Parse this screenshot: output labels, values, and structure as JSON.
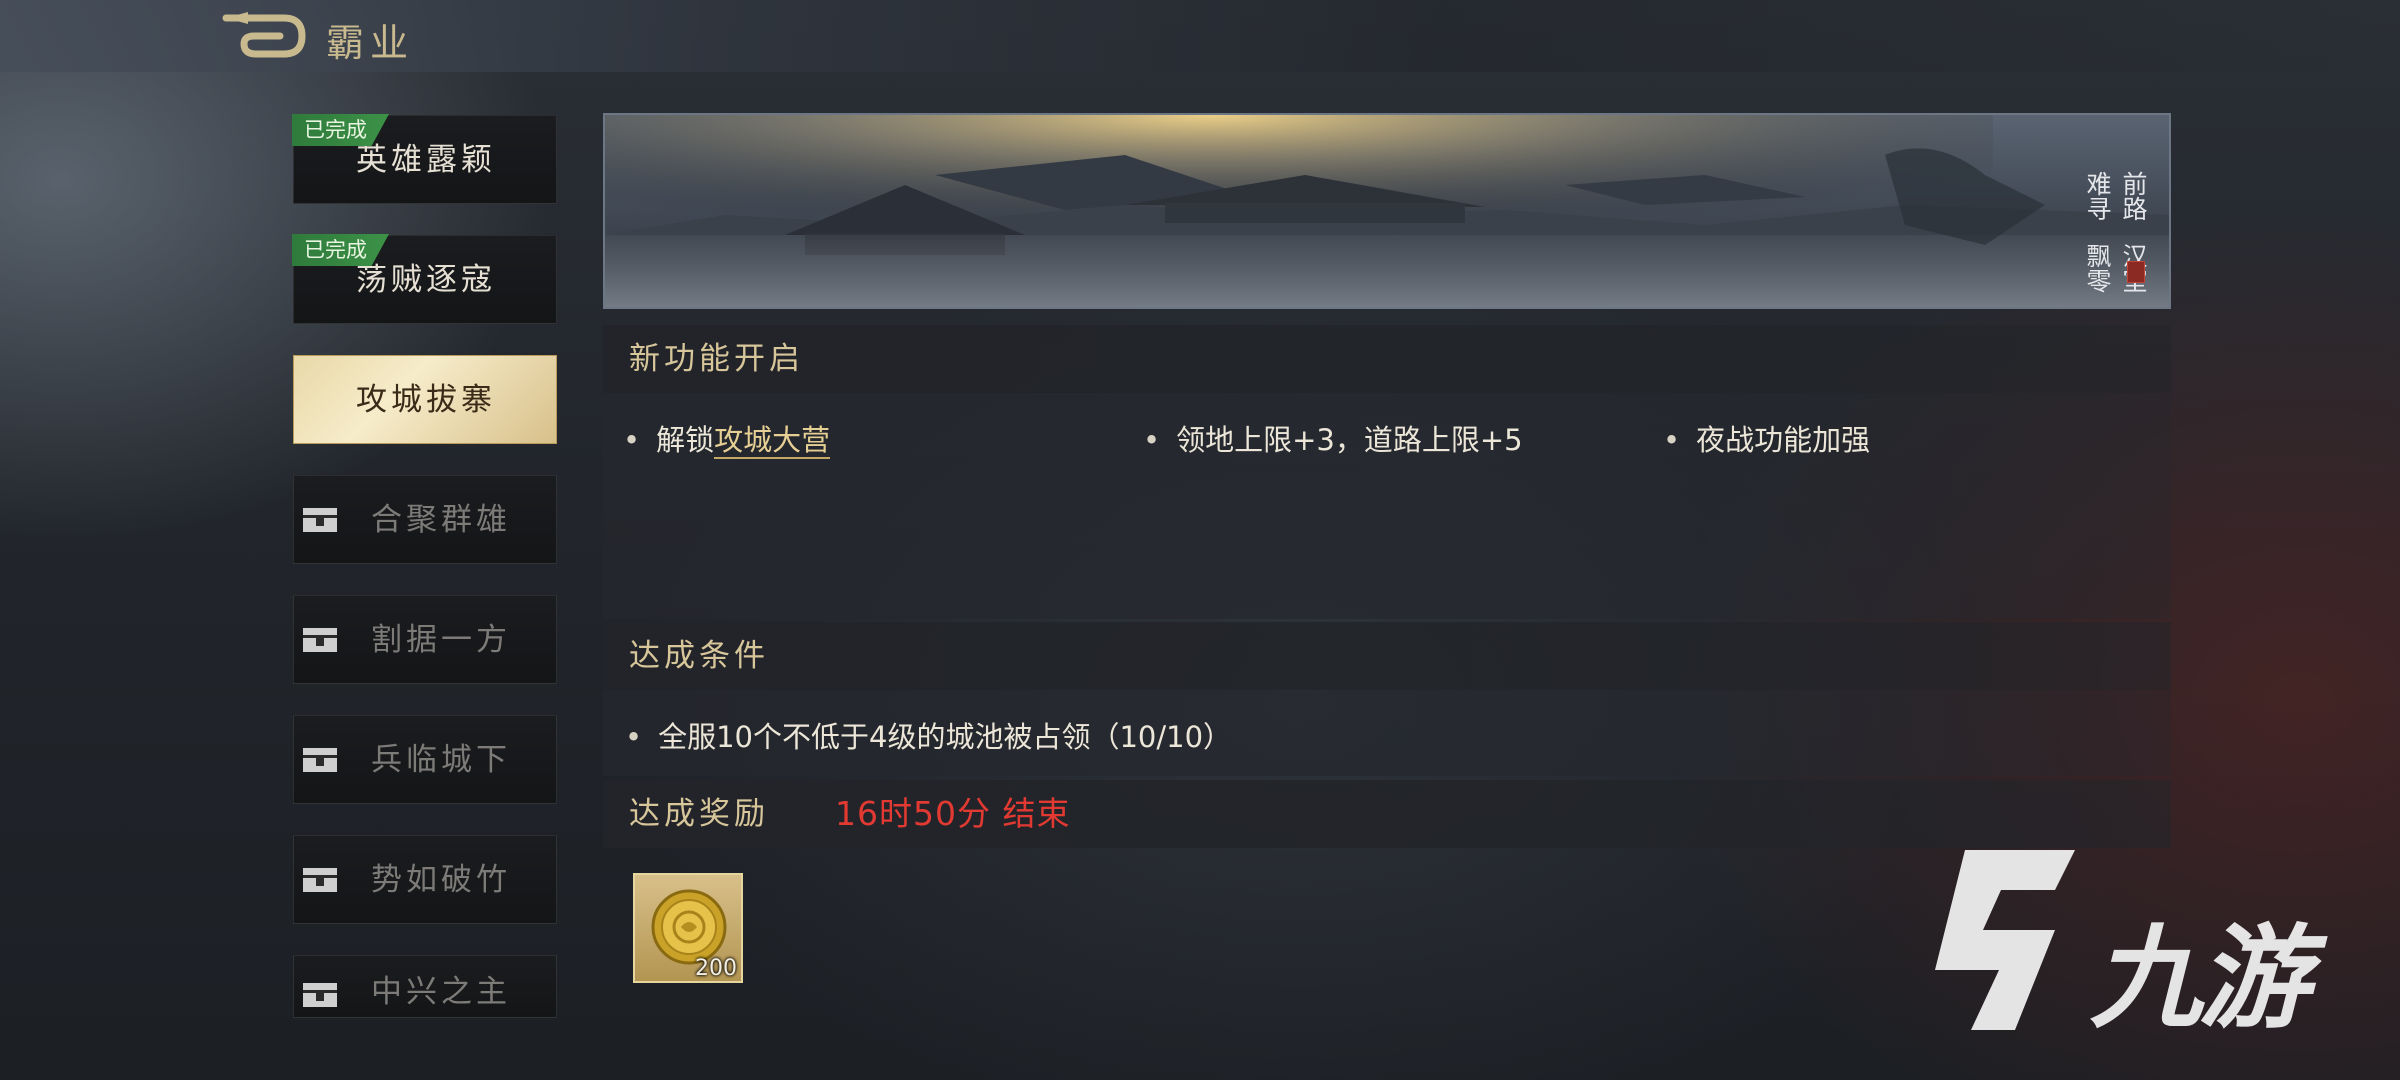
{
  "header": {
    "title": "霸业"
  },
  "sidebar": {
    "items": [
      {
        "label": "英雄露颖",
        "status": "done",
        "badge": "已完成"
      },
      {
        "label": "荡贼逐寇",
        "status": "done",
        "badge": "已完成"
      },
      {
        "label": "攻城拔寨",
        "status": "active"
      },
      {
        "label": "合聚群雄",
        "status": "locked"
      },
      {
        "label": "割据一方",
        "status": "locked"
      },
      {
        "label": "兵临城下",
        "status": "locked"
      },
      {
        "label": "势如破竹",
        "status": "locked"
      },
      {
        "label": "中兴之主",
        "status": "locked"
      }
    ]
  },
  "banner": {
    "poem_col1": "汉室飘零",
    "poem_col2": "前路难寻"
  },
  "features_section": {
    "title": "新功能开启",
    "items": [
      {
        "prefix": "解锁",
        "link": "攻城大营"
      },
      {
        "text": "领地上限+3，道路上限+5"
      },
      {
        "text": "夜战功能加强"
      }
    ]
  },
  "condition_section": {
    "title": "达成条件",
    "items": [
      {
        "text": "全服10个不低于4级的城池被占领（10/10）"
      }
    ]
  },
  "reward_section": {
    "title": "达成奖励",
    "timer": "16时50分 结束",
    "items": [
      {
        "icon": "gold-coin-icon",
        "quantity": "200"
      }
    ]
  },
  "watermark": {
    "text": "九游"
  },
  "colors": {
    "gold_text": "#d7c69a",
    "timer_red": "#e23a32",
    "done_green": "#3c9247",
    "active_tab": "#f6ecca"
  }
}
